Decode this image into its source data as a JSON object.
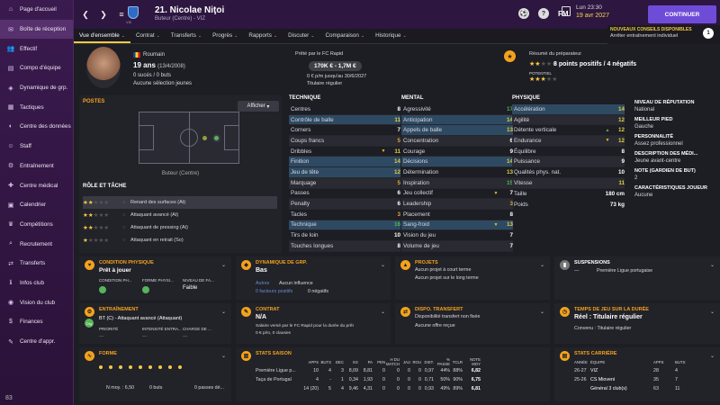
{
  "sidebar": {
    "items": [
      {
        "icon": "home-icon",
        "glyph": "⌂",
        "label": "Page d'accueil"
      },
      {
        "icon": "inbox-icon",
        "glyph": "✉",
        "label": "Boîte de réception"
      },
      {
        "icon": "squad-icon",
        "glyph": "👥",
        "label": "Effectif"
      },
      {
        "icon": "teamsheet-icon",
        "glyph": "▤",
        "label": "Compo d'équipe"
      },
      {
        "icon": "dynamics-icon",
        "glyph": "◈",
        "label": "Dynamique de grp."
      },
      {
        "icon": "tactics-icon",
        "glyph": "▦",
        "label": "Tactiques"
      },
      {
        "icon": "data-hub-icon",
        "glyph": "◐",
        "label": "Centre des données"
      },
      {
        "icon": "staff-icon",
        "glyph": "☺",
        "label": "Staff"
      },
      {
        "icon": "training-icon",
        "glyph": "⚙",
        "label": "Entraînement"
      },
      {
        "icon": "medical-icon",
        "glyph": "✚",
        "label": "Centre médical"
      },
      {
        "icon": "calendar-icon",
        "glyph": "▣",
        "label": "Calendrier"
      },
      {
        "icon": "competitions-icon",
        "glyph": "♛",
        "label": "Compétitions"
      },
      {
        "icon": "scouting-icon",
        "glyph": "⌕",
        "label": "Recrutement"
      },
      {
        "icon": "transfers-icon",
        "glyph": "⇄",
        "label": "Transferts"
      },
      {
        "icon": "club-info-icon",
        "glyph": "ℹ",
        "label": "Infos club"
      },
      {
        "icon": "club-vision-icon",
        "glyph": "◉",
        "label": "Vision du club"
      },
      {
        "icon": "finances-icon",
        "glyph": "$",
        "label": "Finances"
      },
      {
        "icon": "dev-centre-icon",
        "glyph": "✎",
        "label": "Centre d'appr."
      }
    ],
    "bottom": "83"
  },
  "topbar": {
    "club_label": "VIZ",
    "player_title": "21. Nicolae Niţoi",
    "player_sub": "Buteur (Centre) - VIZ",
    "fm": "FM",
    "date1": "Lun 23:30",
    "date2": "19 avr 2027",
    "continue": "CONTINUER"
  },
  "notification": {
    "title": "NOUVEAUX CONSEILS DISPONIBLES",
    "text": "Arrêter entraînement individuel",
    "count": "1"
  },
  "tabs": [
    {
      "label": "Vue d'ensemble",
      "dd": true
    },
    {
      "label": "Contrat",
      "dd": true
    },
    {
      "label": "Transferts",
      "dd": true
    },
    {
      "label": "Progrès",
      "dd": true
    },
    {
      "label": "Rapports",
      "dd": true
    },
    {
      "label": "Discuter",
      "dd": true
    },
    {
      "label": "Comparaison",
      "dd": true
    },
    {
      "label": "Historique",
      "dd": true
    }
  ],
  "header": {
    "nationality": "Roumain",
    "age": "19 ans",
    "dob": "(13/4/2008)",
    "goals": "0 sucés / 0 buts",
    "selection": "Aucune sélection jeunes",
    "loan_label": "Prêté par le FC Rapid",
    "value": "170K € - 1,7M €",
    "wage": "0 € p/m jusqu'au 30/6/2027",
    "status": "Titulaire régulier",
    "report_label": "Résumé du préparateur",
    "report_text": "8 points positifs / 4 négatifs",
    "potential_label": "POTENTIEL"
  },
  "positions": {
    "title": "POSTES",
    "show": "Afficher",
    "caption": "Buteur (Centre)"
  },
  "roles": {
    "title": "RÔLE ET TÂCHE",
    "items": [
      {
        "stars": "★★★★★",
        "dim": 3,
        "label": "Renard des surfaces (At)"
      },
      {
        "stars": "★★★★★",
        "dim": 3,
        "label": "Attaquant avancé (At)"
      },
      {
        "stars": "★★★★★",
        "dim": 3,
        "label": "Attaquant de pressing (At)"
      },
      {
        "stars": "★★★★★",
        "dim": 4,
        "label": "Attaquant en retrait (So)"
      }
    ]
  },
  "technique": {
    "title": "TECHNIQUE",
    "rows": [
      [
        "Centres",
        "",
        "8"
      ],
      [
        "Contrôle de balle",
        "",
        "11"
      ],
      [
        "Corners",
        "",
        "7"
      ],
      [
        "Coups francs",
        "",
        "5"
      ],
      [
        "Dribbles",
        "dn",
        "11"
      ],
      [
        "Finition",
        "",
        "14"
      ],
      [
        "Jeu de tête",
        "",
        "12"
      ],
      [
        "Marquage",
        "",
        "5"
      ],
      [
        "Passes",
        "",
        "6"
      ],
      [
        "Penalty",
        "",
        "6"
      ],
      [
        "Tacles",
        "",
        "3"
      ],
      [
        "Technique",
        "",
        "16"
      ],
      [
        "Tirs de loin",
        "",
        "10"
      ],
      [
        "Touches longues",
        "",
        "8"
      ]
    ]
  },
  "mental": {
    "title": "MENTAL",
    "rows": [
      [
        "Agressivité",
        "",
        "17"
      ],
      [
        "Anticipation",
        "",
        "14"
      ],
      [
        "Appels de balle",
        "",
        "13"
      ],
      [
        "Concentration",
        "",
        "6"
      ],
      [
        "Courage",
        "",
        "9"
      ],
      [
        "Décisions",
        "",
        "14"
      ],
      [
        "Détermination",
        "",
        "13"
      ],
      [
        "Inspiration",
        "",
        "15"
      ],
      [
        "Jeu collectif",
        "dn",
        "7"
      ],
      [
        "Leadership",
        "",
        "3"
      ],
      [
        "Placement",
        "",
        "8"
      ],
      [
        "Sang-froid",
        "dn",
        "13"
      ],
      [
        "Vision du jeu",
        "",
        "7"
      ],
      [
        "Volume de jeu",
        "",
        "7"
      ]
    ]
  },
  "physique": {
    "title": "PHYSIQUE",
    "rows": [
      [
        "Accélération",
        "",
        "14"
      ],
      [
        "Agilité",
        "",
        "12"
      ],
      [
        "Détente verticale",
        "up",
        "12"
      ],
      [
        "Endurance",
        "dn",
        "12"
      ],
      [
        "Équilibre",
        "",
        "8"
      ],
      [
        "Puissance",
        "",
        "9"
      ],
      [
        "Qualités phys. nat.",
        "",
        "10"
      ],
      [
        "Vitesse",
        "",
        "11"
      ]
    ],
    "height_label": "Taille",
    "height": "180 cm",
    "weight_label": "Poids",
    "weight": "73 kg"
  },
  "profile": [
    {
      "k": "NIVEAU DE RÉPUTATION",
      "v": "National"
    },
    {
      "k": "MEILLEUR PIED",
      "v": "Gauche"
    },
    {
      "k": "PERSONNALITÉ",
      "v": "Assez professionnel"
    },
    {
      "k": "DESCRIPTION DES MÉDI...",
      "v": "Jeune avant-centre"
    },
    {
      "k": "NOTE (GARDIEN DE BUT)",
      "v": "2"
    },
    {
      "k": "CARACTÉRISTIQUES JOUEUR",
      "v": "Aucune"
    }
  ],
  "cards": {
    "condition": {
      "title": "CONDITION PHYSIQUE",
      "value": "Prêt à jouer",
      "h1": "CONDITION PH...",
      "h2": "FORME PHYSI...",
      "h3": "NIVEAU DE FA...",
      "v3": "Faible"
    },
    "dynamics": {
      "title": "DYNAMIQUE DE GRP.",
      "value": "Bas",
      "others": "Autres",
      "others_val": "Aucun influence",
      "factors": "0 facteurs positifs",
      "neg": "0 négatifs"
    },
    "projects": {
      "title": "PROJETS",
      "l1": "Aucun projet à court terme",
      "l2": "Aucun projet sur le long terme"
    },
    "suspensions": {
      "title": "SUSPENSIONS",
      "value": "Première Ligue portugaise"
    },
    "training": {
      "title": "ENTRAÎNEMENT",
      "value": "BT (C) - Attaquant avancé (Attaquant)",
      "h1": "PRIORITÉ",
      "h2": "INTENSITÉ ENTRA...",
      "h3": "CHARGE DE ..."
    },
    "contract": {
      "title": "CONTRAT",
      "value": "N/A",
      "l1": "Salaire versé par le FC Rapid pour la durée du prêt",
      "l2": "0 € p/m, 0 clauses"
    },
    "transfer": {
      "title": "DISPO. TRANSFERT",
      "l1": "Disponibilité transfert non fixée",
      "l2": "Aucune offre reçue"
    },
    "playtime": {
      "title": "TEMPS DE JEU SUR LA DURÉE",
      "value": "Réel : Titulaire régulier",
      "l1": "Convenu : Titulaire régulier"
    },
    "form": {
      "title": "FORME",
      "l1": "N moy. : 6,50",
      "l2": "0 buts",
      "l3": "0 passes dé..."
    },
    "season": {
      "title": "STATS SAISON",
      "headers": [
        "APPS",
        "BUTS",
        "DEC",
        "XG",
        "PA",
        "PEN",
        "H DU MATCH",
        "JAU",
        "ROU",
        "DIST.",
        "% PASSE",
        "TCLR",
        "NOTE MOY"
      ],
      "rows": [
        {
          "name": "Première Ligue p...",
          "vals": [
            "10",
            "4",
            "3",
            "8,09",
            "8,81",
            "0",
            "0",
            "0",
            "0",
            "0,97",
            "44%",
            "88%",
            "6,82"
          ]
        },
        {
          "name": "Taça de Portugal",
          "vals": [
            "4",
            "-",
            "1",
            "0,34",
            "1,93",
            "0",
            "0",
            "0",
            "0",
            "0,71",
            "50%",
            "90%",
            "6,75"
          ]
        },
        {
          "name": "",
          "vals": [
            "14 (20)",
            "5",
            "4",
            "9,46",
            "4,31",
            "0",
            "0",
            "0",
            "0",
            "0,93",
            "49%",
            "89%",
            "6,81"
          ]
        }
      ]
    },
    "career": {
      "title": "STATS CARRIÈRE",
      "h1": "ANNÉE",
      "h2": "ÉQUIPE",
      "h3": "APPS",
      "h4": "BUTS",
      "rows": [
        {
          "y": "26-27",
          "t": "VIZ",
          "a": "28",
          "b": "4"
        },
        {
          "y": "25-26",
          "t": "CS Mioveni",
          "a": "35",
          "b": "7"
        },
        {
          "y": "",
          "t": "Général 3 club(s)",
          "a": "63",
          "b": "11"
        }
      ]
    }
  },
  "colors": {
    "accent": "#f3c944",
    "purple": "#6f4cd8",
    "sidebar": "#3b1a4f"
  }
}
